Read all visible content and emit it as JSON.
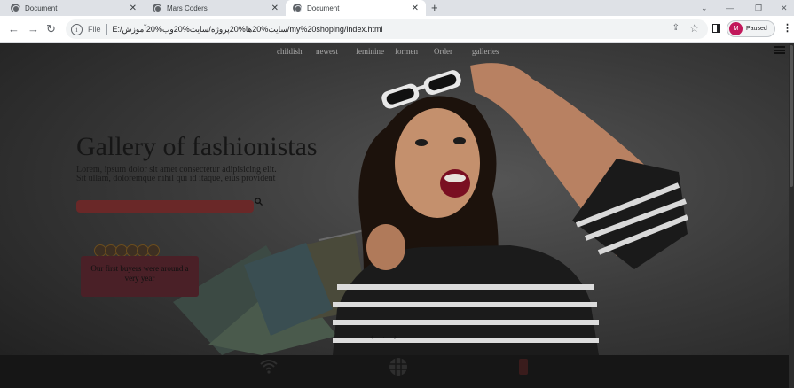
{
  "browser": {
    "tabs": [
      {
        "label": "Document"
      },
      {
        "label": "Mars Coders"
      },
      {
        "label": "Document"
      }
    ],
    "new_tab": "+",
    "url_scheme": "File",
    "url": "E:/سایت%20ها%20پروژه/سایت%20وب%20آموزش/my%20shoping/index.html",
    "profile": {
      "initial": "M",
      "status": "Paused"
    }
  },
  "page": {
    "nav": [
      "childish",
      "newest",
      "feminine",
      "formen",
      "Order",
      "galleries"
    ],
    "hero": {
      "title": "Gallery of fashionistas",
      "body": "Lorem, ipsum dolor sit amet consectetur adipisicing elit. Sit ullam, doloremque nihil qui id itaque, eius provident"
    },
    "testimonial": "Our first buyers were around a very year",
    "carousel_dots": [
      "‹",
      "·",
      "›"
    ]
  },
  "colors": {
    "accent_searchbar": "#6a2828",
    "testimonial_bg": "#4a2027",
    "avatar": "#c2185b"
  }
}
